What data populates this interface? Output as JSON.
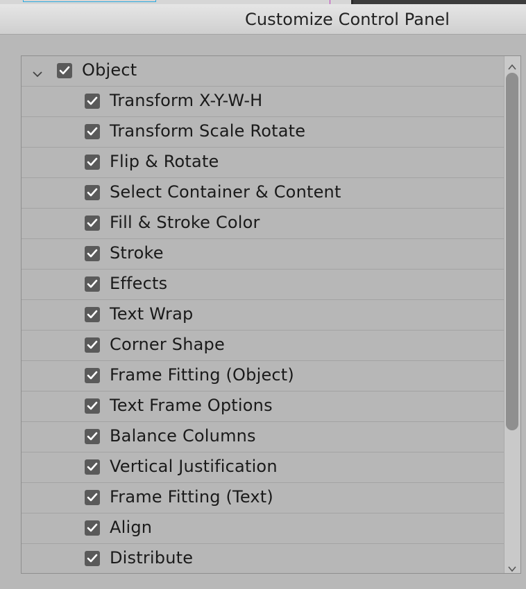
{
  "window": {
    "title": "Customize Control Panel"
  },
  "tree": {
    "root": {
      "label": "Object",
      "checked": true,
      "expanded": true
    },
    "children": [
      {
        "label": "Transform X-Y-W-H",
        "checked": true
      },
      {
        "label": "Transform Scale Rotate",
        "checked": true
      },
      {
        "label": "Flip & Rotate",
        "checked": true
      },
      {
        "label": "Select Container & Content",
        "checked": true
      },
      {
        "label": "Fill & Stroke Color",
        "checked": true
      },
      {
        "label": "Stroke",
        "checked": true
      },
      {
        "label": "Effects",
        "checked": true
      },
      {
        "label": "Text Wrap",
        "checked": true
      },
      {
        "label": "Corner Shape",
        "checked": true
      },
      {
        "label": "Frame Fitting (Object)",
        "checked": true
      },
      {
        "label": "Text Frame Options",
        "checked": true
      },
      {
        "label": "Balance Columns",
        "checked": true
      },
      {
        "label": "Vertical Justification",
        "checked": true
      },
      {
        "label": "Frame Fitting (Text)",
        "checked": true
      },
      {
        "label": "Align",
        "checked": true
      },
      {
        "label": "Distribute",
        "checked": true
      }
    ]
  },
  "icons": {
    "expand": "chevron-down-icon",
    "checkbox": "checkmark-icon",
    "scroll_up": "chevron-up-icon",
    "scroll_down": "chevron-down-icon"
  }
}
